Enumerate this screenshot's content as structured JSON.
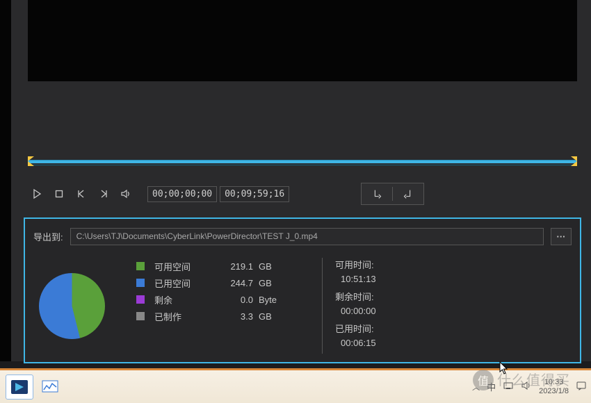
{
  "controls": {
    "time_start": "00;00;00;00",
    "time_end": "00;09;59;16"
  },
  "export": {
    "label": "导出到:",
    "path": "C:\\Users\\TJ\\Documents\\CyberLink\\PowerDirector\\TEST J_0.mp4",
    "more": "···"
  },
  "disk": {
    "items": [
      {
        "swatch": "sw-green",
        "label": "可用空间",
        "value": "219.1",
        "unit": "GB"
      },
      {
        "swatch": "sw-blue",
        "label": "已用空间",
        "value": "244.7",
        "unit": "GB"
      },
      {
        "swatch": "sw-purple",
        "label": "剩余",
        "value": "0.0",
        "unit": "Byte"
      },
      {
        "swatch": "sw-gray",
        "label": "已制作",
        "value": "3.3",
        "unit": "GB"
      }
    ]
  },
  "times": {
    "available_label": "可用时间:",
    "available": "10:51:13",
    "remaining_label": "剩余时间:",
    "remaining": "00:00:00",
    "used_label": "已用时间:",
    "used": "00:06:15"
  },
  "taskbar": {
    "ime": "中",
    "time": "10:33",
    "date": "2023/1/8"
  },
  "watermark": "什么值得买",
  "watermark_badge": "值",
  "chart_data": {
    "type": "pie",
    "title": "",
    "series": [
      {
        "name": "可用空间",
        "value": 219.1,
        "unit": "GB",
        "color": "#5aa03a"
      },
      {
        "name": "已用空间",
        "value": 244.7,
        "unit": "GB",
        "color": "#3b7bd6"
      },
      {
        "name": "剩余",
        "value": 0.0,
        "unit": "Byte",
        "color": "#9b3bd6"
      },
      {
        "name": "已制作",
        "value": 3.3,
        "unit": "GB",
        "color": "#888888"
      }
    ]
  }
}
